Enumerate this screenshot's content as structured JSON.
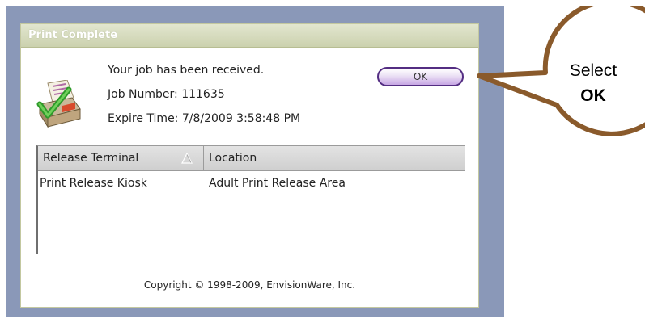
{
  "dialog": {
    "title": "Print Complete",
    "ok_label": "OK",
    "info": {
      "received": "Your job has been received.",
      "job_number": "Job Number: 111635",
      "expire_time": "Expire Time: 7/8/2009 3:58:48 PM"
    },
    "table": {
      "columns": [
        "Release Terminal",
        "Location"
      ],
      "rows": [
        [
          "Print Release Kiosk",
          "Adult Print Release Area"
        ]
      ]
    },
    "copyright": "Copyright © 1998-2009, EnvisionWare, Inc."
  },
  "callout": {
    "line1": "Select",
    "line2": "OK"
  },
  "icons": [
    "printer-check-icon",
    "sort-ascending-icon"
  ],
  "colors": {
    "frame": "#8a98b8",
    "titlebar": "#cbd1ae",
    "ok_border": "#532d82",
    "callout_border": "#8a5a2b"
  }
}
